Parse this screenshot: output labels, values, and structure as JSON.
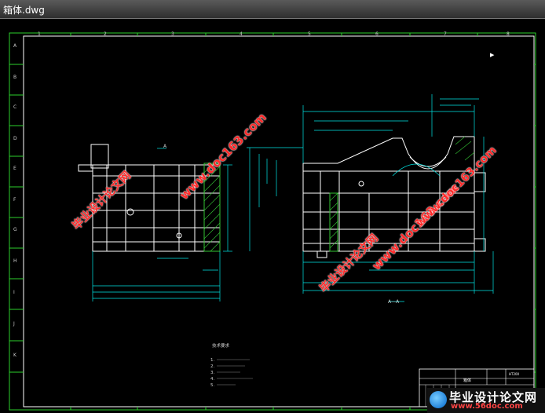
{
  "window": {
    "title": "箱体.dwg"
  },
  "border": {
    "columns": [
      "1",
      "2",
      "3",
      "4",
      "5",
      "6",
      "7",
      "8"
    ],
    "rows": [
      "A",
      "B",
      "C",
      "D",
      "E",
      "F",
      "G",
      "H",
      "I",
      "J",
      "K"
    ]
  },
  "views": {
    "section_a_label": "A",
    "section_aa_label": "A—A"
  },
  "tech_requirements": {
    "title": "技术要求",
    "items": [
      "1.",
      "2.",
      "3.",
      "4.",
      "5."
    ]
  },
  "watermarks": {
    "left_diag": "www.doc163.com",
    "left_cn": "毕业设计论文网",
    "right_diag": "www.doc163.com",
    "right_cn": "毕业设计论文网"
  },
  "badge": {
    "line1": "毕业设计论文网",
    "line2": "www.56doc.com"
  },
  "title_block": {
    "cell1": "箱体",
    "cell2": "HT200"
  },
  "colors": {
    "outline": "#ffffff",
    "dimension": "#00e5e5",
    "hatch": "#35c435",
    "frame": "#2ccf2c",
    "watermark": "#ff2b2b"
  }
}
